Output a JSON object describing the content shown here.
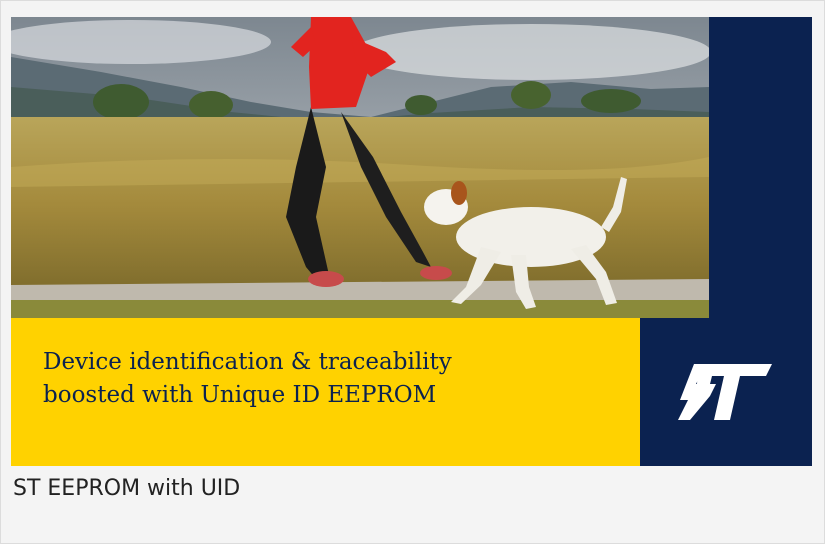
{
  "banner": {
    "caption": "Device identification & traceability\nboosted with Unique ID EEPROM",
    "logo": {
      "icon": "st-logo-icon",
      "text": "ST",
      "color": "#ffffff"
    },
    "colors": {
      "navy": "#0b2250",
      "yellow": "#ffd200"
    }
  },
  "card": {
    "title": "ST EEPROM with UID"
  }
}
